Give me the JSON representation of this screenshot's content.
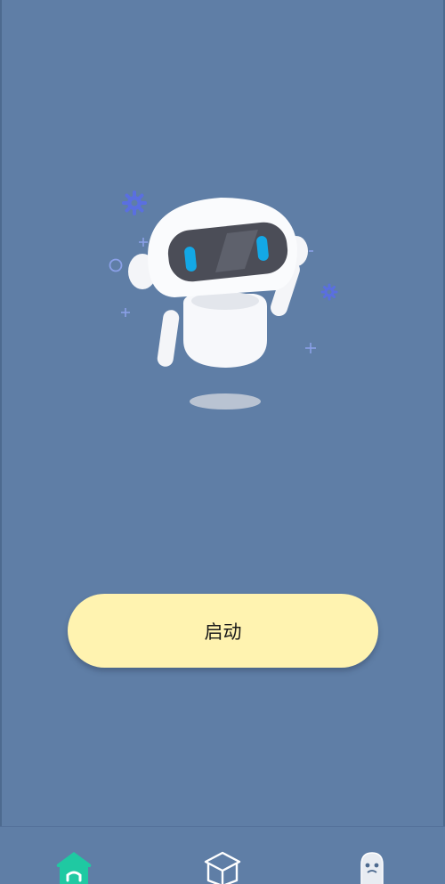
{
  "main": {
    "start_button_label": "启动"
  },
  "hero": {
    "illustration": "robot-mascot",
    "decor_icons": [
      "gear-icon",
      "gear-icon",
      "plus-icon",
      "plus-icon",
      "plus-icon",
      "circle-icon"
    ]
  },
  "bottom_nav": {
    "items": [
      {
        "icon": "home-icon",
        "active": true
      },
      {
        "icon": "box-icon",
        "active": false
      },
      {
        "icon": "ghost-icon",
        "active": false
      }
    ],
    "active_color": "#1fc9a2",
    "inactive_color": "#ffffff"
  },
  "colors": {
    "background": "#5f7ea6",
    "button": "#fff3b0",
    "robot_eye": "#13a8e6",
    "decor": "#5a6fe0"
  }
}
